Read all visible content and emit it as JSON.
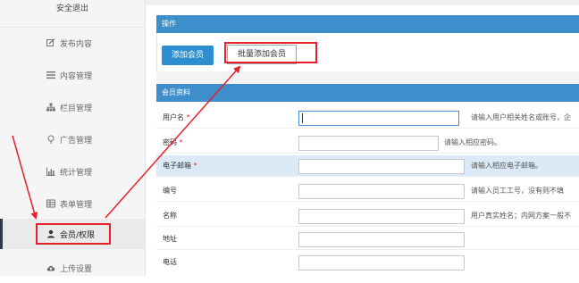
{
  "sidebar": {
    "logout": "安全退出",
    "items": [
      {
        "label": "发布内容",
        "icon": "edit-icon"
      },
      {
        "label": "内容管理",
        "icon": "list-icon"
      },
      {
        "label": "栏目管理",
        "icon": "sitemap-icon"
      },
      {
        "label": "广告管理",
        "icon": "pin-icon"
      },
      {
        "label": "统计管理",
        "icon": "bar-chart-icon"
      },
      {
        "label": "表单管理",
        "icon": "table-icon"
      },
      {
        "label": "会员/权限",
        "icon": "user-group-icon"
      },
      {
        "label": "上传设置",
        "icon": "cloud-upload-icon"
      }
    ]
  },
  "ops": {
    "title": "操作",
    "add_member": "添加会员",
    "batch_add": "批量添加会员"
  },
  "profile": {
    "title": "会员资料",
    "fields": [
      {
        "label": "用户名",
        "required": "*",
        "hint": "请输入用户相关姓名或账号，企"
      },
      {
        "label": "密码",
        "required": "*",
        "hint": "请输入相应密码。"
      },
      {
        "label": "电子邮箱",
        "required": "*",
        "hint": "请输入相应电子邮箱。"
      },
      {
        "label": "编号",
        "required": "",
        "hint": "请输入员工工号，没有则不填"
      },
      {
        "label": "名称",
        "required": "",
        "hint": "用户真实姓名；内网方案一般不"
      },
      {
        "label": "地址",
        "required": "",
        "hint": ""
      },
      {
        "label": "电话",
        "required": "",
        "hint": ""
      }
    ]
  },
  "colors": {
    "accent": "#3d8ecb",
    "button": "#2e8ed0",
    "highlight": "#e8202a",
    "row_highlight": "#dbeaf6"
  }
}
